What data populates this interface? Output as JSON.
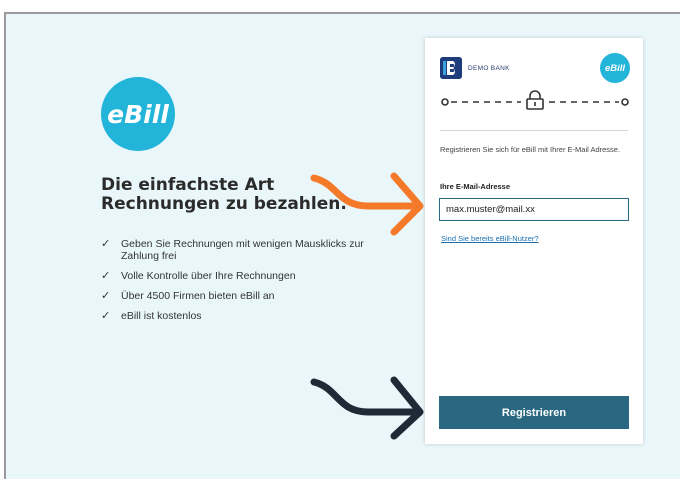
{
  "promo": {
    "logo_text": "eBill",
    "headline_line1": "Die einfachste Art",
    "headline_line2": "Rechnungen zu bezahlen.",
    "features": [
      "Geben Sie Rechnungen mit wenigen Mausklicks zur Zahlung frei",
      "Volle Kontrolle über Ihre Rechnungen",
      "Über 4500 Firmen bieten eBill an",
      "eBill ist kostenlos"
    ]
  },
  "card": {
    "bank_name": "DEMO BANK",
    "ebill_badge": "eBill",
    "intro_text": "Registrieren Sie sich für eBill mit Ihrer E-Mail Adresse.",
    "email_label": "Ihre E-Mail-Adresse",
    "email_value": "max.muster@mail.xx",
    "existing_user_link": "Sind Sie bereits eBill-Nutzer?",
    "register_button": "Registrieren"
  },
  "colors": {
    "background": "#e9f7fb",
    "ebill_blue": "#22b5d9",
    "primary_button": "#2a6882",
    "arrow_orange": "#f47a2a",
    "arrow_dark": "#1e2a36",
    "link": "#1b6fb0"
  },
  "icons": [
    "ebill-logo",
    "demo-bank-logo",
    "lock-icon",
    "check-icon",
    "orange-arrow-annotation",
    "dark-arrow-annotation"
  ]
}
